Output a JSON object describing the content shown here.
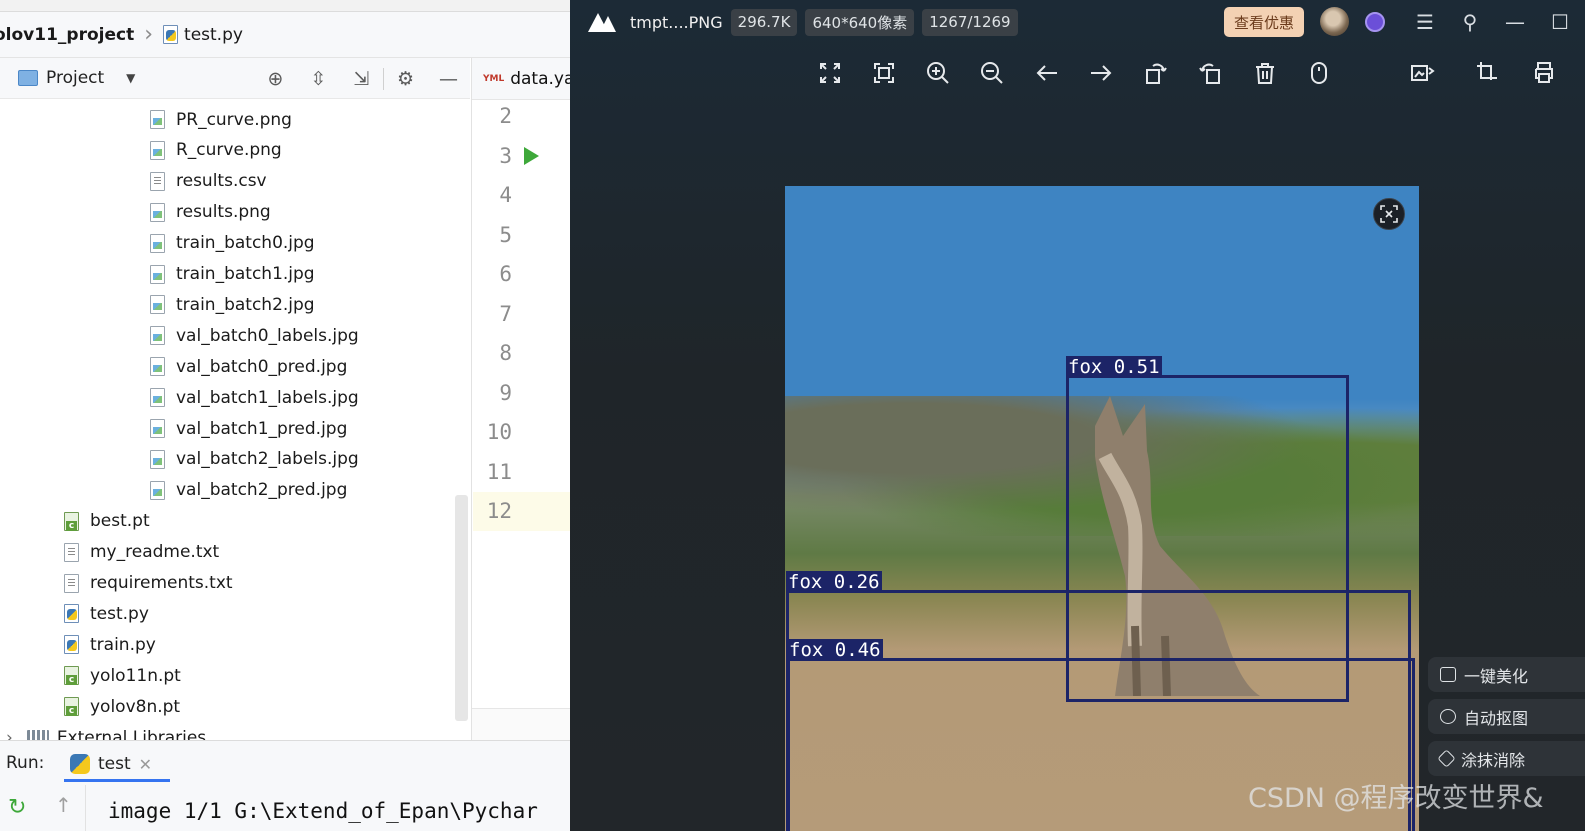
{
  "ide": {
    "breadcrumb": {
      "project": "olov11_project",
      "file": "test.py"
    },
    "project_tool": {
      "label": "Project"
    },
    "tree_items": [
      {
        "name": "PR_curve.png",
        "kind": "img"
      },
      {
        "name": "R_curve.png",
        "kind": "img"
      },
      {
        "name": "results.csv",
        "kind": "txt"
      },
      {
        "name": "results.png",
        "kind": "img"
      },
      {
        "name": "train_batch0.jpg",
        "kind": "img"
      },
      {
        "name": "train_batch1.jpg",
        "kind": "img"
      },
      {
        "name": "train_batch2.jpg",
        "kind": "img"
      },
      {
        "name": "val_batch0_labels.jpg",
        "kind": "img"
      },
      {
        "name": "val_batch0_pred.jpg",
        "kind": "img"
      },
      {
        "name": "val_batch1_labels.jpg",
        "kind": "img"
      },
      {
        "name": "val_batch1_pred.jpg",
        "kind": "img"
      },
      {
        "name": "val_batch2_labels.jpg",
        "kind": "img"
      },
      {
        "name": "val_batch2_pred.jpg",
        "kind": "img"
      },
      {
        "name": "best.pt",
        "kind": "pt"
      },
      {
        "name": "my_readme.txt",
        "kind": "txt"
      },
      {
        "name": "requirements.txt",
        "kind": "txt"
      },
      {
        "name": "test.py",
        "kind": "py"
      },
      {
        "name": "train.py",
        "kind": "py"
      },
      {
        "name": "yolo11n.pt",
        "kind": "pt"
      },
      {
        "name": "yolov8n.pt",
        "kind": "pt"
      },
      {
        "name": "External Libraries",
        "kind": "lib"
      }
    ],
    "editor_tab": {
      "label": "data.ya"
    },
    "line_numbers": [
      "2",
      "3",
      "4",
      "5",
      "6",
      "7",
      "8",
      "9",
      "10",
      "11",
      "12"
    ],
    "current_line": "12",
    "run": {
      "label": "Run:",
      "tab": "test",
      "console_text": "image 1/1 G:\\Extend_of_Epan\\Pychar"
    }
  },
  "viewer": {
    "filename": "tmpt....PNG",
    "file_size": "296.7K",
    "resolution": "640*640像素",
    "position": "1267/1269",
    "promo_label": "查看优惠",
    "toolbar_icons": [
      "fit-screen-icon",
      "fullscreen-icon",
      "zoom-in-icon",
      "zoom-out-icon",
      "previous-icon",
      "next-icon",
      "rotate-left-icon",
      "rotate-right-icon",
      "delete-icon",
      "mouse-icon",
      "edit-image-icon",
      "crop-icon",
      "print-icon"
    ],
    "detections": [
      {
        "label": "fox 0.51",
        "confidence": 0.51
      },
      {
        "label": "fox 0.26",
        "confidence": 0.26
      },
      {
        "label": "fox 0.46",
        "confidence": 0.46
      }
    ],
    "ai_tools": [
      {
        "label": "一键美化"
      },
      {
        "label": "自动抠图"
      },
      {
        "label": "涂抹消除"
      }
    ],
    "watermark": "CSDN @程序改变世界&",
    "accent": "#1c2467"
  }
}
